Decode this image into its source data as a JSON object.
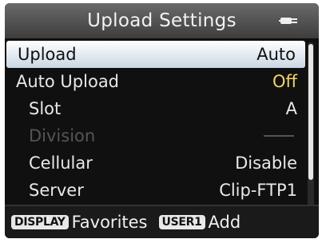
{
  "header": {
    "title": "Upload Settings",
    "icon": "power-plug-icon"
  },
  "menu": {
    "items": [
      {
        "label": "Upload",
        "value": "Auto"
      },
      {
        "label": "Auto Upload",
        "value": "Off"
      },
      {
        "label": "Slot",
        "value": "A"
      },
      {
        "label": "Division",
        "value": ""
      },
      {
        "label": "Cellular",
        "value": "Disable"
      },
      {
        "label": "Server",
        "value": "Clip-FTP1"
      }
    ]
  },
  "footer": {
    "display_key": "DISPLAY",
    "display_action": "Favorites",
    "user_key": "USER1",
    "user_action": "Add"
  },
  "colors": {
    "accent_value": "#f0d36a",
    "selection_bg": "#ffffff",
    "disabled_text": "#555555"
  }
}
